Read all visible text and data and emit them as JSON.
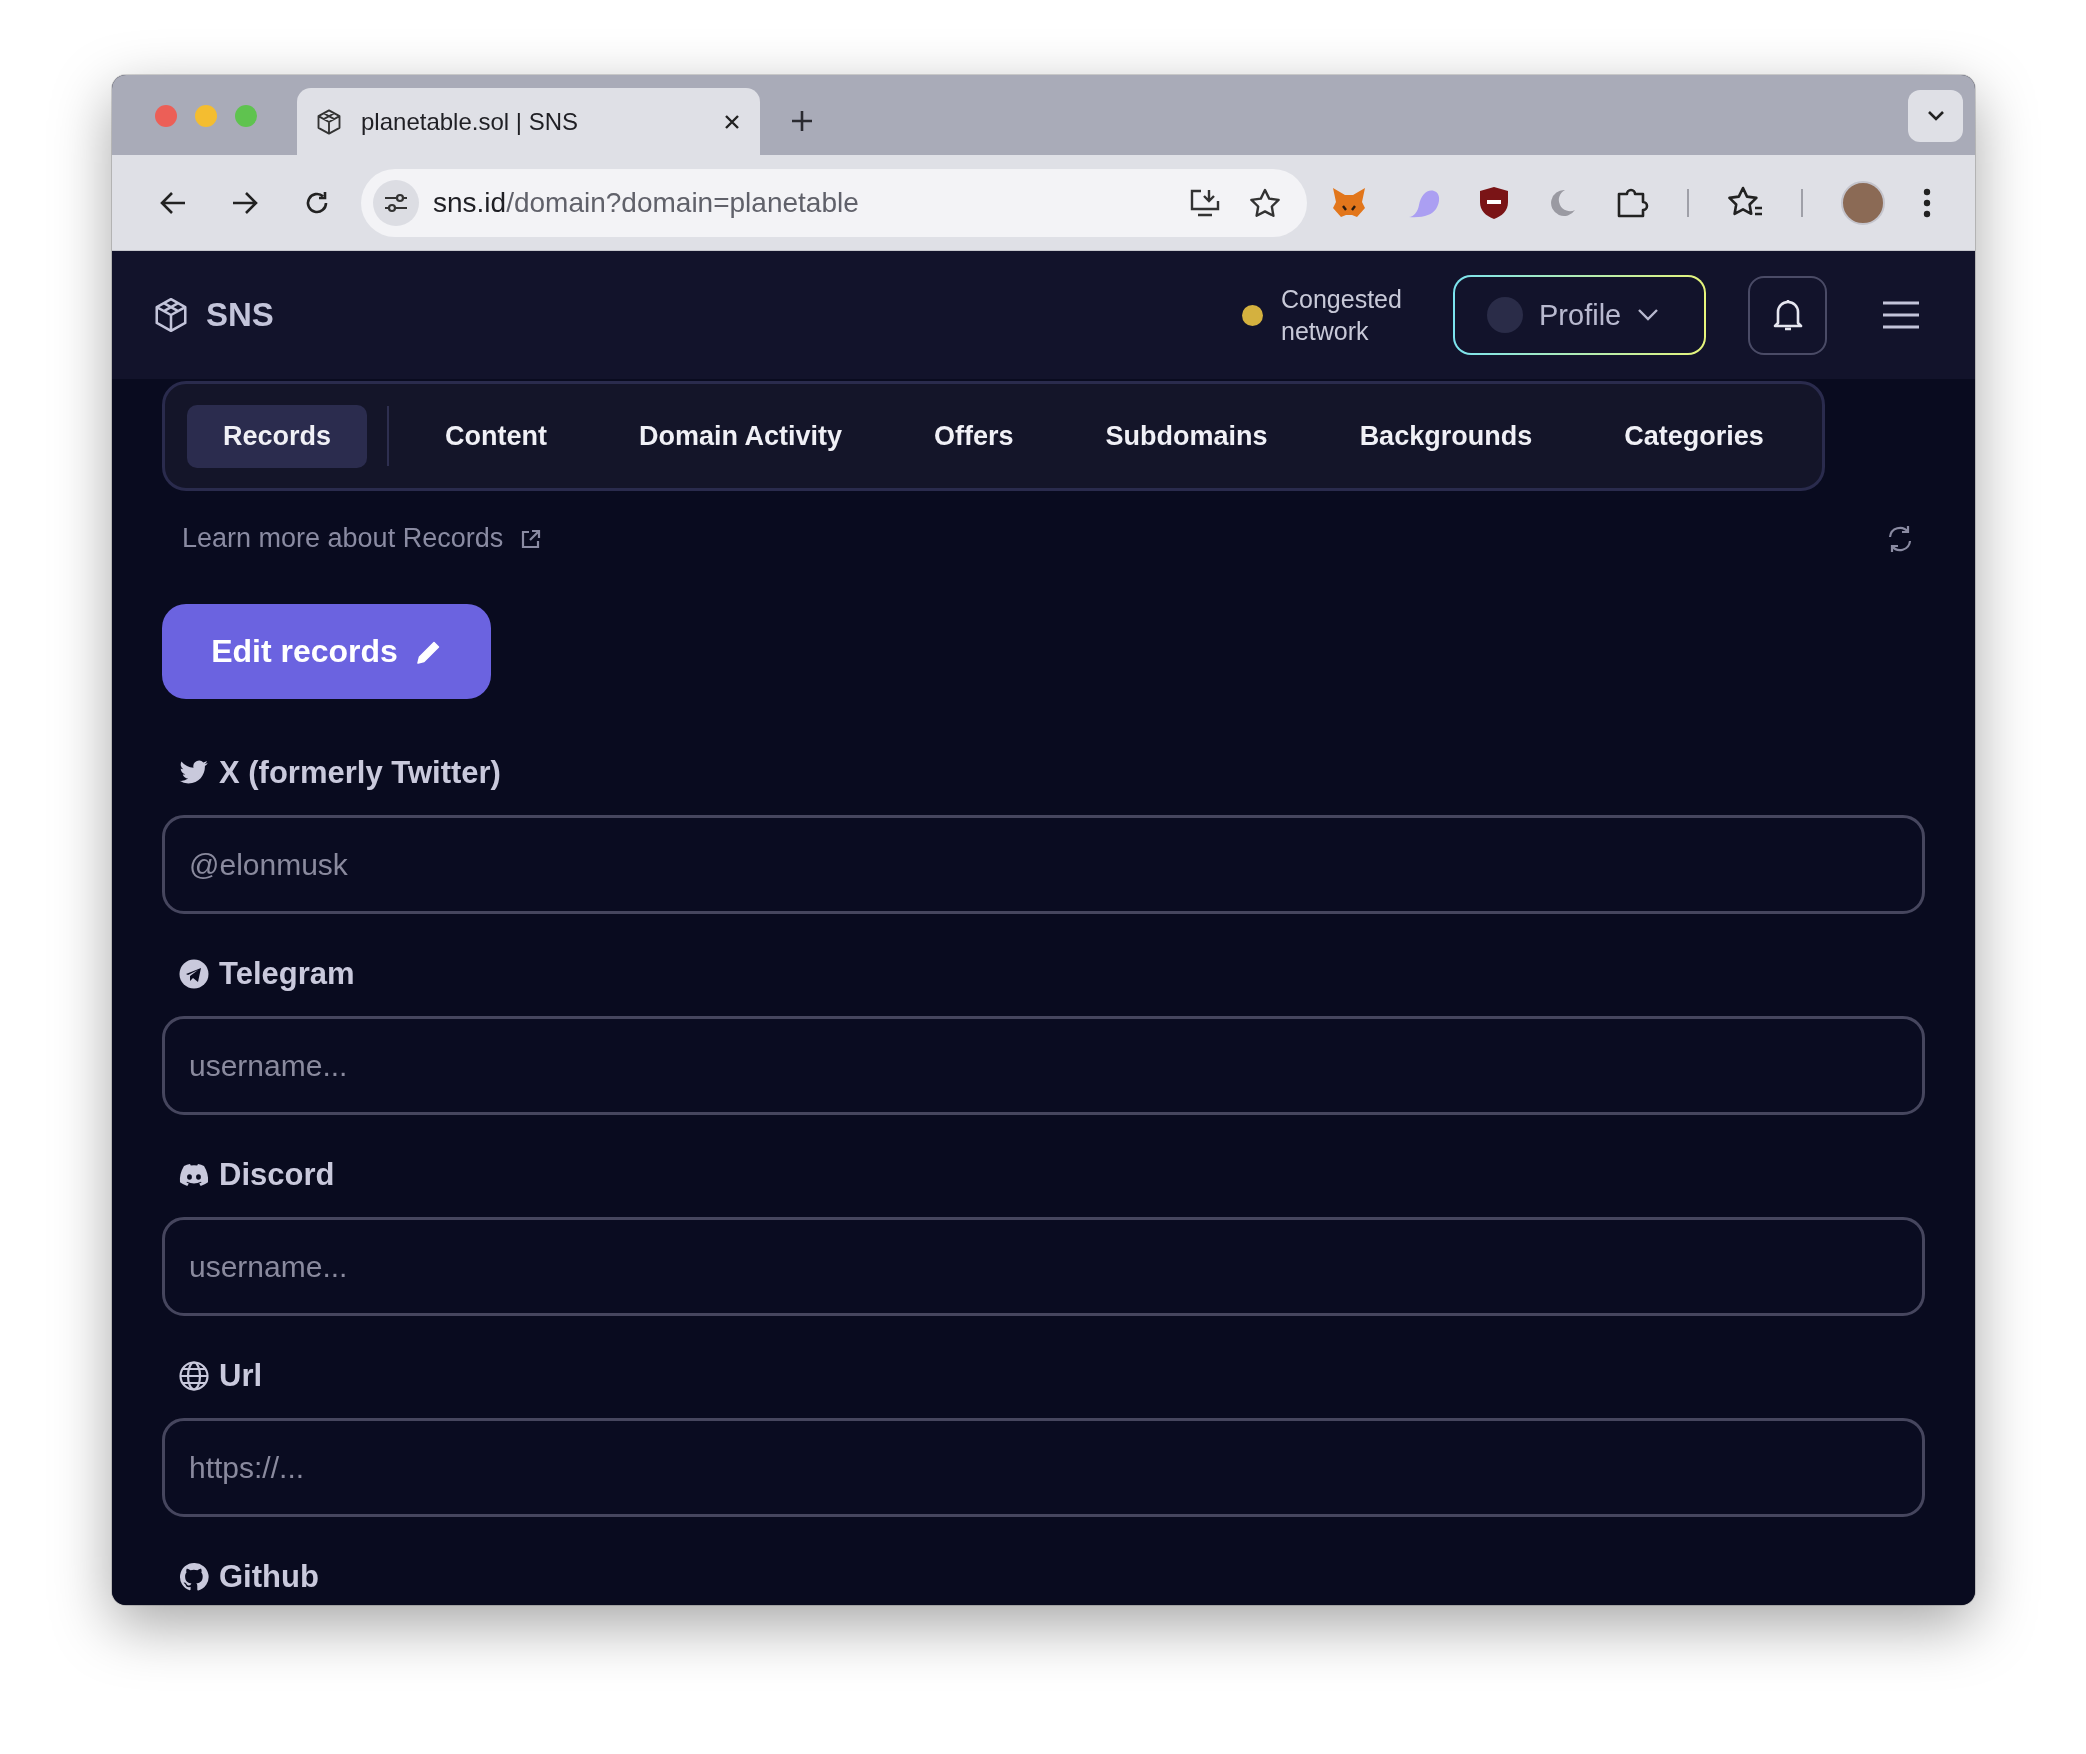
{
  "browser": {
    "tab_title": "planetable.sol | SNS",
    "url_host": "sns.id",
    "url_path": "/domain?domain=planetable"
  },
  "header": {
    "brand": "SNS",
    "network": {
      "text": "Congested network",
      "color": "#d4b13f"
    },
    "profile_button": "Profile"
  },
  "tabs": [
    {
      "label": "Records",
      "selected": true
    },
    {
      "label": "Content",
      "selected": false
    },
    {
      "label": "Domain Activity",
      "selected": false
    },
    {
      "label": "Offers",
      "selected": false
    },
    {
      "label": "Subdomains",
      "selected": false
    },
    {
      "label": "Backgrounds",
      "selected": false
    },
    {
      "label": "Categories",
      "selected": false
    }
  ],
  "learn_more": "Learn more about Records",
  "edit_button": "Edit records",
  "records": [
    {
      "kind": "twitter",
      "label": "X (formerly Twitter)",
      "placeholder": "@elonmusk"
    },
    {
      "kind": "telegram",
      "label": "Telegram",
      "placeholder": "username..."
    },
    {
      "kind": "discord",
      "label": "Discord",
      "placeholder": "username..."
    },
    {
      "kind": "url",
      "label": "Url",
      "placeholder": "https://..."
    },
    {
      "kind": "github",
      "label": "Github"
    }
  ]
}
